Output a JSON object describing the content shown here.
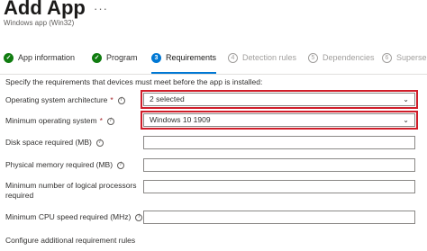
{
  "header": {
    "title": "Add App",
    "more_glyph": "···",
    "subtitle": "Windows app (Win32)"
  },
  "steps": [
    {
      "label": "App information",
      "state": "done",
      "marker": "✓"
    },
    {
      "label": "Program",
      "state": "done",
      "marker": "✓"
    },
    {
      "label": "Requirements",
      "state": "active",
      "marker": "3"
    },
    {
      "label": "Detection rules",
      "state": "todo",
      "marker": "4"
    },
    {
      "label": "Dependencies",
      "state": "todo",
      "marker": "5"
    },
    {
      "label": "Superse",
      "state": "todo",
      "marker": "6"
    }
  ],
  "form": {
    "intro": "Specify the requirements that devices must meet before the app is installed:",
    "os_arch": {
      "label": "Operating system architecture",
      "required_mark": "*",
      "value": "2 selected"
    },
    "min_os": {
      "label": "Minimum operating system",
      "required_mark": "*",
      "value": "Windows 10 1909"
    },
    "disk_space": {
      "label": "Disk space required (MB)",
      "value": ""
    },
    "physical_memory": {
      "label": "Physical memory required (MB)",
      "value": ""
    },
    "logical_processors": {
      "label_line1": "Minimum number of logical processors",
      "label_line2": "required",
      "value": ""
    },
    "cpu_speed": {
      "label": "Minimum CPU speed required (MHz)",
      "value": ""
    },
    "additional_rules": "Configure additional requirement rules"
  },
  "icons": {
    "info": "i",
    "chevron": "⌄"
  },
  "colors": {
    "accent": "#0078d4",
    "done": "#107c10",
    "highlight": "#d01e2a",
    "required": "#a4262c"
  }
}
